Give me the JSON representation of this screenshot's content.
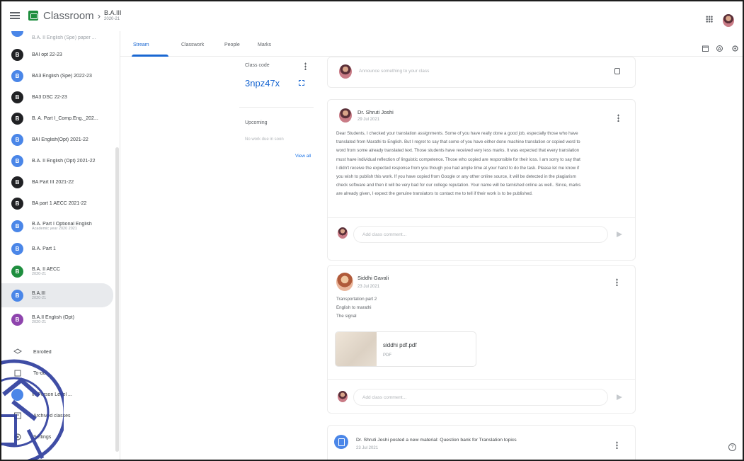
{
  "header": {
    "app_name": "Classroom",
    "breadcrumb_sep": "›",
    "class_title": "B.A.III",
    "class_sub": "2020-21"
  },
  "sidebar": {
    "items": [
      {
        "letter": "",
        "label": "B.A. II English (Spe) paper ...",
        "sub": "",
        "color": "#4a86e8"
      },
      {
        "letter": "B",
        "label": "BAI opt 22-23",
        "sub": "",
        "color": "#202124"
      },
      {
        "letter": "B",
        "label": "BA3 English (Spe) 2022-23",
        "sub": "",
        "color": "#4a86e8"
      },
      {
        "letter": "B",
        "label": "BA3 DSC 22-23",
        "sub": "",
        "color": "#202124"
      },
      {
        "letter": "B",
        "label": "B. A. Part I_Comp.Eng._202...",
        "sub": "",
        "color": "#202124"
      },
      {
        "letter": "B",
        "label": "BAI English(Opt) 2021-22",
        "sub": "",
        "color": "#4a86e8"
      },
      {
        "letter": "B",
        "label": "B.A. II English (Opt) 2021-22",
        "sub": "",
        "color": "#4a86e8"
      },
      {
        "letter": "B",
        "label": "BA Part III 2021-22",
        "sub": "",
        "color": "#202124"
      },
      {
        "letter": "B",
        "label": "BA part 1 AECC 2021-22",
        "sub": "",
        "color": "#202124"
      },
      {
        "letter": "B",
        "label": "B.A. Part I Optional English",
        "sub": "Academic year 2020 2021",
        "color": "#4a86e8"
      },
      {
        "letter": "B",
        "label": "B.A. Part 1",
        "sub": "",
        "color": "#4a86e8"
      },
      {
        "letter": "B",
        "label": "B.A. II AECC",
        "sub": "2020-21",
        "color": "#1e8e3e"
      },
      {
        "letter": "B",
        "label": "B.A.III",
        "sub": "2020-21",
        "color": "#4a86e8"
      },
      {
        "letter": "B",
        "label": "B.A.II English (Opt)",
        "sub": "2020-21",
        "color": "#8e44ad"
      }
    ],
    "enrolled": "Enrolled",
    "to_review": "To-do",
    "inperson": "In-Person Level ...",
    "archived": "Archived classes",
    "settings": "Settings"
  },
  "tabs": [
    {
      "label": "Stream"
    },
    {
      "label": "Classwork"
    },
    {
      "label": "People"
    },
    {
      "label": "Marks"
    }
  ],
  "info": {
    "class_code_label": "Class code",
    "class_code": "3npz47x",
    "upcoming_label": "Upcoming",
    "upcoming_sub": "No work due in soon",
    "view_all": "View all"
  },
  "stream": {
    "announce_placeholder": "Announce something to your class",
    "post1": {
      "author": "Dr. Shruti Joshi",
      "date": "29 Jul 2021",
      "lines": [
        "Dear Students, I checked your translation assignments. Some of you have really done a good job, especially those who have",
        "translated from Marathi to English. But I regret to say that some of you have either done machine translation or copied word to",
        "word from some already translated text. Those students have received very less marks. It was expected that every translation",
        "must have individual reflection of linguistic competence. Those who copied are responsible for their loss. I am sorry to say that",
        "I didn't receive the expected response from you though you had ample time at your hand to do the task. Please let me know if",
        "you wish to publish this work. If you have copied from Google or any other online source, it will be detected in the plagiarism",
        "check software and then it will be very bad for our college reputation. Your name will be tarnished online as well.. Since, marks",
        "are already given, I expect the genuine translators to contact me to tell if their work is to be published."
      ],
      "comment_placeholder": "Add class comment..."
    },
    "post2": {
      "author": "Siddhi Gavali",
      "date": "23 Jul 2021",
      "lines": [
        "Transportation part 2",
        "English to marathi",
        "The signal"
      ],
      "attachment_name": "siddhi pdf.pdf",
      "attachment_type": "PDF",
      "comment_placeholder": "Add class comment..."
    },
    "post3": {
      "text": "Dr. Shruti Joshi posted a new material: Question bank for Translation topics",
      "date": "23 Jul 2021"
    }
  },
  "help": "?"
}
